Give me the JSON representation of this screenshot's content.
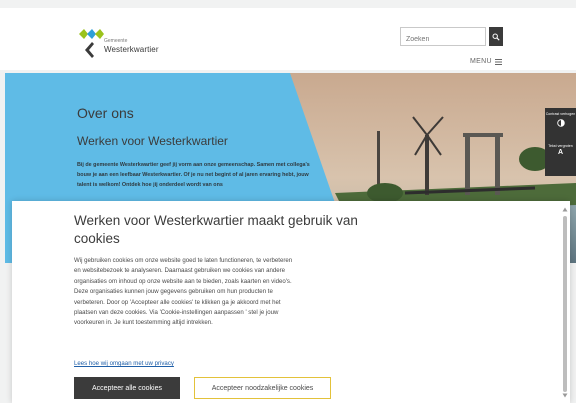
{
  "header": {
    "logo": {
      "small_text": "Gemeente",
      "name": "Westerkwartier"
    },
    "search": {
      "placeholder": "Zoeken"
    },
    "menu_label": "MENU"
  },
  "hero": {
    "title": "Over ons",
    "subtitle": "Werken voor Westerkwartier",
    "intro": "Bij de gemeente Westerkwartier geef jij vorm aan onze gemeenschap. Samen met collega's bouw je aan een leefbaar Westerkwartier. Of je nu net begint of al jaren ervaring hebt, jouw talent is welkom! Ontdek hoe jij onderdeel wordt van ons"
  },
  "side_tools": {
    "contrast_label": "Contrast verhogen",
    "text_size_label": "Tekst vergroten",
    "text_size_glyph": "A"
  },
  "cookie_dialog": {
    "title": "Werken voor Westerkwartier maakt gebruik van cookies",
    "body": "Wij gebruiken cookies om onze website goed te laten functioneren, te verbeteren en websitebezoek te analyseren. Daarnaast gebruiken we cookies van andere organisaties om inhoud op onze website aan te bieden, zoals kaarten en video's. Deze organisaties kunnen jouw gegevens gebruiken om hun producten te verbeteren. Door op 'Accepteer alle cookies' te klikken ga je akkoord met het plaatsen van deze cookies. Via 'Cookie-instellingen aanpassen ' stel je jouw voorkeuren in. Je kunt toestemming altijd intrekken.",
    "link": "Lees hoe wij omgaan met uw privacy",
    "accept_all": "Accepteer alle cookies",
    "accept_necessary": "Accepteer noodzakelijke cookies"
  },
  "colors": {
    "hero_blue": "#5fbbe6",
    "logo_green": "#9bc31c",
    "logo_blue": "#2d9fd9",
    "dark": "#3b3b3b",
    "button_border": "#e3c23a"
  }
}
